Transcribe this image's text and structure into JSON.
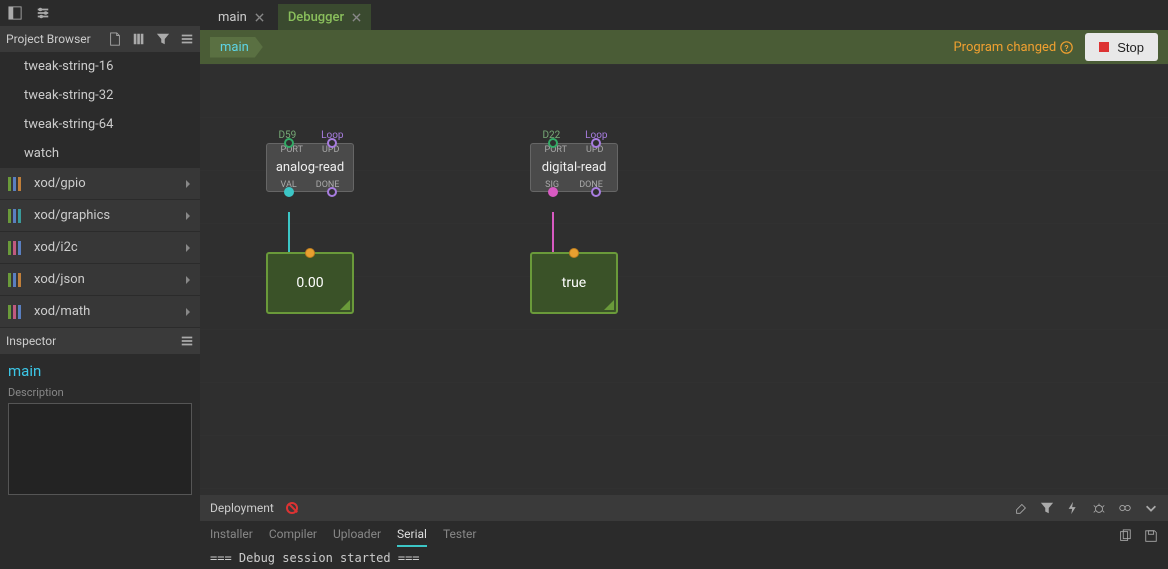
{
  "project_browser": {
    "title": "Project Browser",
    "items": [
      "tweak-string-16",
      "tweak-string-32",
      "tweak-string-64",
      "watch"
    ]
  },
  "libraries": [
    {
      "name": "xod/gpio",
      "colors": [
        "#6a9a3a",
        "#5a7fc0",
        "#c07f3a"
      ]
    },
    {
      "name": "xod/graphics",
      "colors": [
        "#6a9a3a",
        "#5a7fc0",
        "#3a9a9a"
      ]
    },
    {
      "name": "xod/i2c",
      "colors": [
        "#6a9a3a",
        "#c05a7f",
        "#5a7fc0"
      ]
    },
    {
      "name": "xod/json",
      "colors": [
        "#6a9a3a",
        "#5a7fc0",
        "#c07f3a"
      ]
    },
    {
      "name": "xod/math",
      "colors": [
        "#6a9a3a",
        "#c05a7f",
        "#5a7fc0"
      ]
    }
  ],
  "inspector": {
    "title": "Inspector",
    "patch": "main",
    "desc_label": "Description",
    "desc_value": ""
  },
  "tabs": [
    {
      "label": "main",
      "active": false
    },
    {
      "label": "Debugger",
      "active": true
    }
  ],
  "breadcrumb": "main",
  "status": "Program changed",
  "stop_label": "Stop",
  "nodes": {
    "analog": {
      "in1": "D59",
      "in2": "Loop",
      "port": "PORT",
      "upd": "UPD",
      "title": "analog-read",
      "out1": "VAL",
      "out2": "DONE"
    },
    "digital": {
      "in1": "D22",
      "in2": "Loop",
      "port": "PORT",
      "upd": "UPD",
      "title": "digital-read",
      "out1": "SIG",
      "out2": "DONE"
    }
  },
  "watch_values": {
    "analog": "0.00",
    "digital": "true"
  },
  "deployment": {
    "title": "Deployment",
    "tabs": [
      "Installer",
      "Compiler",
      "Uploader",
      "Serial",
      "Tester"
    ],
    "active_tab": "Serial",
    "log_line": "=== Debug session started ==="
  }
}
